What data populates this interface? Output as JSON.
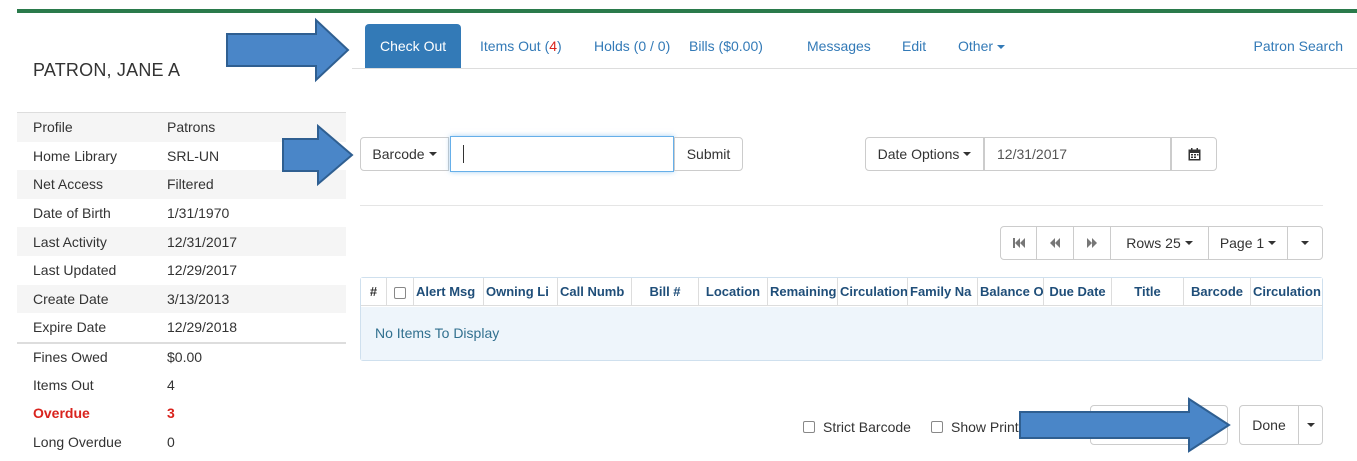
{
  "patron": {
    "name": "PATRON, JANE A"
  },
  "nav": {
    "check_out": "Check Out",
    "items_out_label": "Items Out (",
    "items_out_count": "4",
    "items_out_close": ")",
    "holds": "Holds (0 / 0)",
    "bills": "Bills ($0.00)",
    "messages": "Messages",
    "edit": "Edit",
    "other": "Other",
    "patron_search": "Patron Search"
  },
  "summary": [
    {
      "label": "Profile",
      "value": "Patrons"
    },
    {
      "label": "Home Library",
      "value": "SRL-UN"
    },
    {
      "label": "Net Access",
      "value": "Filtered"
    },
    {
      "label": "Date of Birth",
      "value": "1/31/1970"
    },
    {
      "label": "Last Activity",
      "value": "12/31/2017"
    },
    {
      "label": "Last Updated",
      "value": "12/29/2017"
    },
    {
      "label": "Create Date",
      "value": "3/13/2013"
    },
    {
      "label": "Expire Date",
      "value": "12/29/2018"
    },
    {
      "label": "Fines Owed",
      "value": "$0.00"
    },
    {
      "label": "Items Out",
      "value": "4"
    },
    {
      "label": "Overdue",
      "value": "3"
    },
    {
      "label": "Long Overdue",
      "value": "0"
    }
  ],
  "checkout": {
    "barcode_dropdown": "Barcode",
    "barcode_value": "",
    "submit": "Submit",
    "date_options": "Date Options",
    "date_value": "12/31/2017"
  },
  "pager": {
    "rows": "Rows 25",
    "page": "Page 1"
  },
  "grid": {
    "columns": [
      "#",
      "",
      "Alert Msg",
      "Owning Li",
      "Call Numb",
      "Bill #",
      "Location",
      "Remaining",
      "Circulation",
      "Family Na",
      "Balance O",
      "Due Date",
      "Title",
      "Barcode",
      "Circulation"
    ],
    "empty_message": "No Items To Display"
  },
  "footer": {
    "strict_barcode": "Strict Barcode",
    "show_print": "Show Print",
    "done": "Done"
  },
  "colors": {
    "accent": "#337ab7",
    "overdue": "#d9231d",
    "arrow_fill": "#4a86c8",
    "topbar": "#2a7a4b"
  }
}
